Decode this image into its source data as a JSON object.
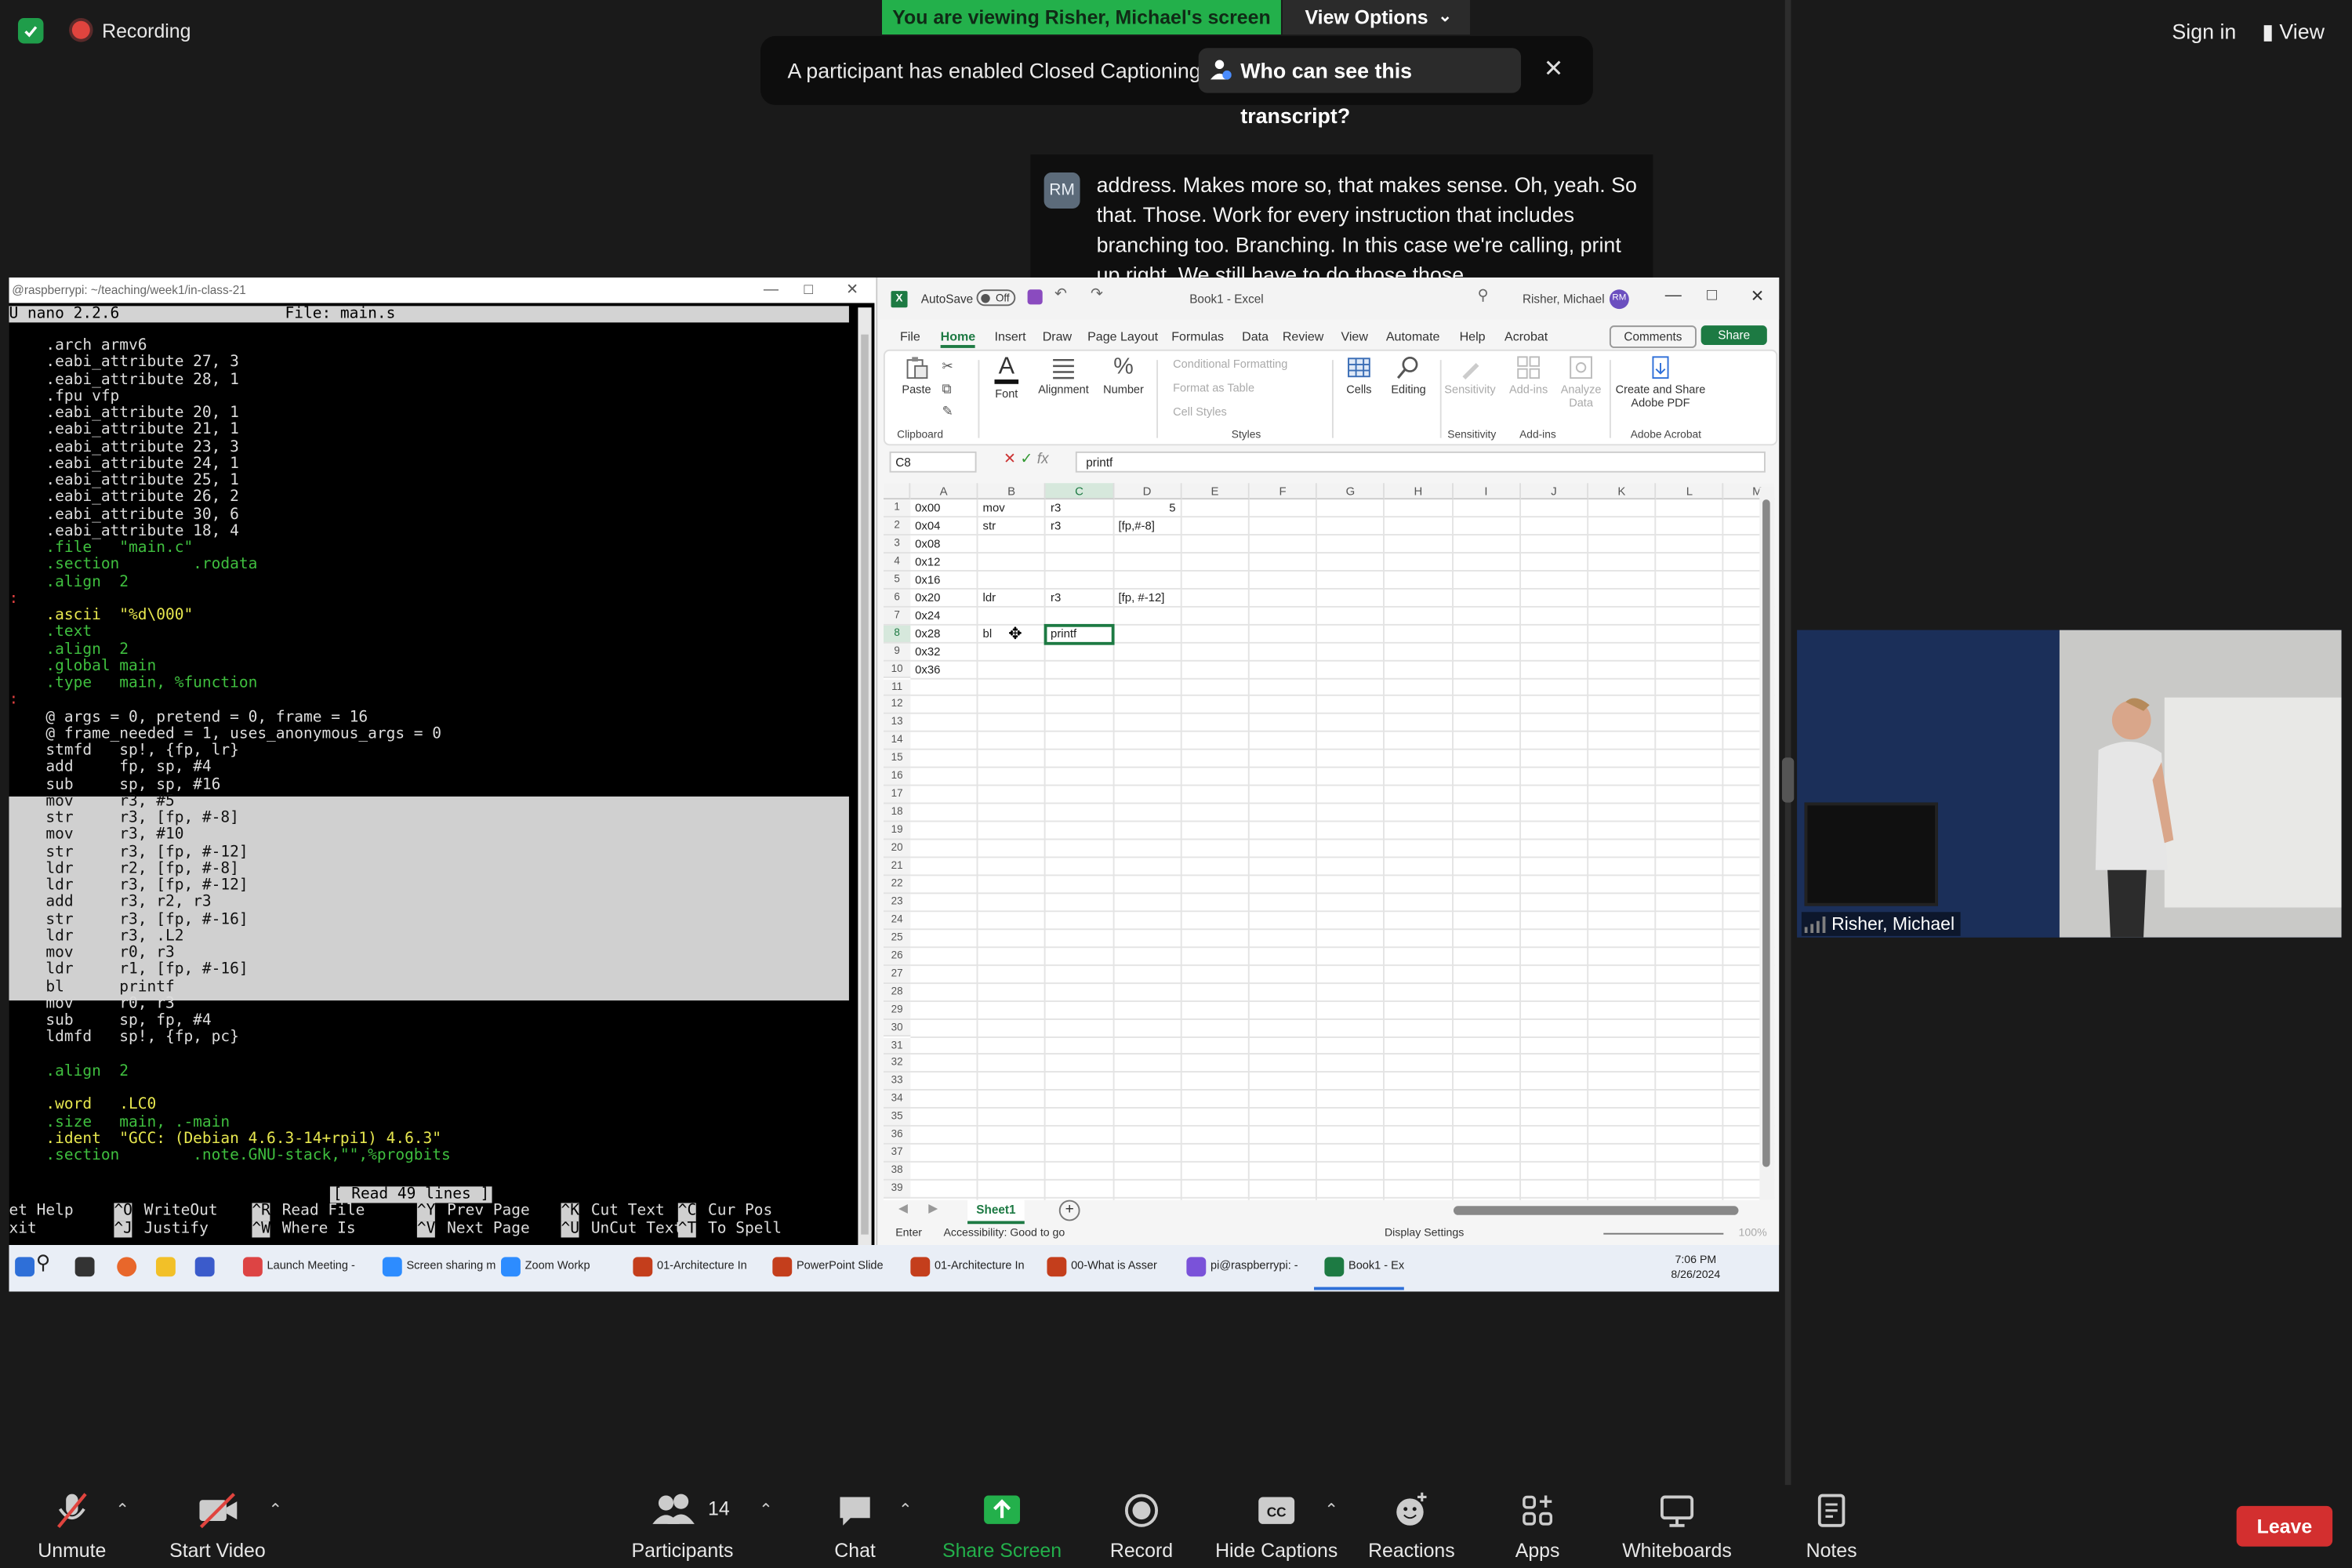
{
  "zoom_top": {
    "recording": "Recording",
    "viewing_banner": "You are viewing Risher, Michael's screen",
    "view_options": "View Options",
    "cc_notice": "A participant has enabled Closed Captioning",
    "cc_who": "Who can see this transcript?",
    "sign_in": "Sign in",
    "view": "View"
  },
  "caption": {
    "initials": "RM",
    "text": "address. Makes more so, that makes sense. Oh, yeah. So that. Those. Work for every instruction that includes branching too. Branching. In this case we're calling, print up right. We still have to do those those."
  },
  "terminal": {
    "title": "@raspberrypi: ~/teaching/week1/in-class-21",
    "header": "U nano 2.2.6                  File: main.s",
    "lines": [
      {
        "t": "    .arch armv6",
        "c": ""
      },
      {
        "t": "    .eabi_attribute 27, 3",
        "c": ""
      },
      {
        "t": "    .eabi_attribute 28, 1",
        "c": ""
      },
      {
        "t": "    .fpu vfp",
        "c": ""
      },
      {
        "t": "    .eabi_attribute 20, 1",
        "c": ""
      },
      {
        "t": "    .eabi_attribute 21, 1",
        "c": ""
      },
      {
        "t": "    .eabi_attribute 23, 3",
        "c": ""
      },
      {
        "t": "    .eabi_attribute 24, 1",
        "c": ""
      },
      {
        "t": "    .eabi_attribute 25, 1",
        "c": ""
      },
      {
        "t": "    .eabi_attribute 26, 2",
        "c": ""
      },
      {
        "t": "    .eabi_attribute 30, 6",
        "c": ""
      },
      {
        "t": "    .eabi_attribute 18, 4",
        "c": ""
      },
      {
        "t": "    .file   \"main.c\"",
        "c": "dir"
      },
      {
        "t": "    .section        .rodata",
        "c": "dir"
      },
      {
        "t": "    .align  2",
        "c": "dir"
      },
      {
        "t": ":",
        "c": "red"
      },
      {
        "t": "    .ascii  \"%d\\000\"",
        "c": "str"
      },
      {
        "t": "    .text",
        "c": "dir"
      },
      {
        "t": "    .align  2",
        "c": "dir"
      },
      {
        "t": "    .global main",
        "c": "dir"
      },
      {
        "t": "    .type   main, %function",
        "c": "dir"
      },
      {
        "t": ":",
        "c": "red"
      },
      {
        "t": "    @ args = 0, pretend = 0, frame = 16",
        "c": ""
      },
      {
        "t": "    @ frame_needed = 1, uses_anonymous_args = 0",
        "c": ""
      },
      {
        "t": "    stmfd   sp!, {fp, lr}",
        "c": ""
      },
      {
        "t": "    add     fp, sp, #4",
        "c": ""
      },
      {
        "t": "    sub     sp, sp, #16",
        "c": ""
      },
      {
        "t": "    mov     r3, #5",
        "c": "hi"
      },
      {
        "t": "    str     r3, [fp, #-8]",
        "c": "hi"
      },
      {
        "t": "    mov     r3, #10",
        "c": "hi"
      },
      {
        "t": "    str     r3, [fp, #-12]",
        "c": "hi"
      },
      {
        "t": "    ldr     r2, [fp, #-8]",
        "c": "hi"
      },
      {
        "t": "    ldr     r3, [fp, #-12]",
        "c": "hi"
      },
      {
        "t": "    add     r3, r2, r3",
        "c": "hi"
      },
      {
        "t": "    str     r3, [fp, #-16]",
        "c": "hi"
      },
      {
        "t": "    ldr     r3, .L2",
        "c": "hi"
      },
      {
        "t": "    mov     r0, r3",
        "c": "hi"
      },
      {
        "t": "    ldr     r1, [fp, #-16]",
        "c": "hi"
      },
      {
        "t": "    bl      printf",
        "c": "hi"
      },
      {
        "t": "    mov     r0, r3",
        "c": ""
      },
      {
        "t": "    sub     sp, fp, #4",
        "c": ""
      },
      {
        "t": "    ldmfd   sp!, {fp, pc}",
        "c": ""
      },
      {
        "t": "",
        "c": ""
      },
      {
        "t": "    .align  2",
        "c": "dir"
      },
      {
        "t": "",
        "c": ""
      },
      {
        "t": "    .word   .LC0",
        "c": "str"
      },
      {
        "t": "    .size   main, .-main",
        "c": "dir"
      },
      {
        "t": "    .ident  \"GCC: (Debian 4.6.3-14+rpi1) 4.6.3\"",
        "c": "str"
      },
      {
        "t": "    .section        .note.GNU-stack,\"\",%progbits",
        "c": "dir"
      }
    ],
    "status": "[ Read 49 lines ]",
    "keys_row1": [
      {
        "k": "",
        "l": "et Help"
      },
      {
        "k": "^O",
        "l": "WriteOut"
      },
      {
        "k": "^R",
        "l": "Read File"
      },
      {
        "k": "^Y",
        "l": "Prev Page"
      },
      {
        "k": "^K",
        "l": "Cut Text"
      },
      {
        "k": "^C",
        "l": "Cur Pos"
      }
    ],
    "keys_row2": [
      {
        "k": "",
        "l": "xit"
      },
      {
        "k": "^J",
        "l": "Justify"
      },
      {
        "k": "^W",
        "l": "Where Is"
      },
      {
        "k": "^V",
        "l": "Next Page"
      },
      {
        "k": "^U",
        "l": "UnCut Text"
      },
      {
        "k": "^T",
        "l": "To Spell"
      }
    ]
  },
  "excel": {
    "autosave": "AutoSave",
    "autosave_state": "Off",
    "book": "Book1 - Excel",
    "user": "Risher, Michael",
    "user_initials": "RM",
    "tabs": [
      "File",
      "Home",
      "Insert",
      "Draw",
      "Page Layout",
      "Formulas",
      "Data",
      "Review",
      "View",
      "Automate",
      "Help",
      "Acrobat"
    ],
    "comments": "Comments",
    "share": "Share",
    "ribbon": {
      "paste": "Paste",
      "font": "Font",
      "alignment": "Alignment",
      "number": "Number",
      "cond_format": "Conditional Formatting",
      "format_table": "Format as Table",
      "cell_styles": "Cell Styles",
      "cells": "Cells",
      "editing": "Editing",
      "sensitivity": "Sensitivity",
      "addins": "Add-ins",
      "analyze": "Analyze Data",
      "create_pdf": "Create and Share Adobe PDF",
      "g_clipboard": "Clipboard",
      "g_styles": "Styles",
      "g_sensitivity": "Sensitivity",
      "g_addins": "Add-ins",
      "g_acrobat": "Adobe Acrobat"
    },
    "namebox": "C8",
    "formula": "printf",
    "columns": [
      "A",
      "B",
      "C",
      "D",
      "E",
      "F",
      "G",
      "H",
      "I",
      "J",
      "K",
      "L",
      "M"
    ],
    "rows_count": 39,
    "cells": [
      {
        "r": 1,
        "c": "A",
        "v": "0x00"
      },
      {
        "r": 1,
        "c": "B",
        "v": "mov"
      },
      {
        "r": 1,
        "c": "C",
        "v": "r3"
      },
      {
        "r": 1,
        "c": "D",
        "v": "5",
        "align": "right"
      },
      {
        "r": 2,
        "c": "A",
        "v": "0x04"
      },
      {
        "r": 2,
        "c": "B",
        "v": "str"
      },
      {
        "r": 2,
        "c": "C",
        "v": "r3"
      },
      {
        "r": 2,
        "c": "D",
        "v": "[fp,#-8]"
      },
      {
        "r": 3,
        "c": "A",
        "v": "0x08"
      },
      {
        "r": 4,
        "c": "A",
        "v": "0x12"
      },
      {
        "r": 5,
        "c": "A",
        "v": "0x16"
      },
      {
        "r": 6,
        "c": "A",
        "v": "0x20"
      },
      {
        "r": 6,
        "c": "B",
        "v": "ldr"
      },
      {
        "r": 6,
        "c": "C",
        "v": "r3"
      },
      {
        "r": 6,
        "c": "D",
        "v": "[fp, #-12]"
      },
      {
        "r": 7,
        "c": "A",
        "v": "0x24"
      },
      {
        "r": 8,
        "c": "A",
        "v": "0x28"
      },
      {
        "r": 8,
        "c": "B",
        "v": "bl"
      },
      {
        "r": 8,
        "c": "C",
        "v": "printf"
      },
      {
        "r": 9,
        "c": "A",
        "v": "0x32"
      },
      {
        "r": 10,
        "c": "A",
        "v": "0x36"
      }
    ],
    "sheet_tab": "Sheet1",
    "status_mode": "Enter",
    "status_access": "Accessibility: Good to go",
    "status_display": "Display Settings",
    "zoom": "100%"
  },
  "taskbar": {
    "items": [
      "Launch Meeting -",
      "Screen sharing m",
      "Zoom Workp",
      "01-Architecture In",
      "PowerPoint Slide",
      "01-Architecture In",
      "00-What is Asser",
      "pi@raspberrypi: -",
      "Book1 - Ex"
    ],
    "time": "7:06 PM",
    "date": "8/26/2024"
  },
  "video": {
    "name": "Risher, Michael"
  },
  "toolbar": {
    "unmute": "Unmute",
    "start_video": "Start Video",
    "participants": "Participants",
    "participants_count": "14",
    "chat": "Chat",
    "share": "Share Screen",
    "record": "Record",
    "captions": "Hide Captions",
    "reactions": "Reactions",
    "apps": "Apps",
    "whiteboards": "Whiteboards",
    "notes": "Notes",
    "leave": "Leave",
    "share_color": "#23b04b",
    "leave_color": "#d32f2f"
  }
}
